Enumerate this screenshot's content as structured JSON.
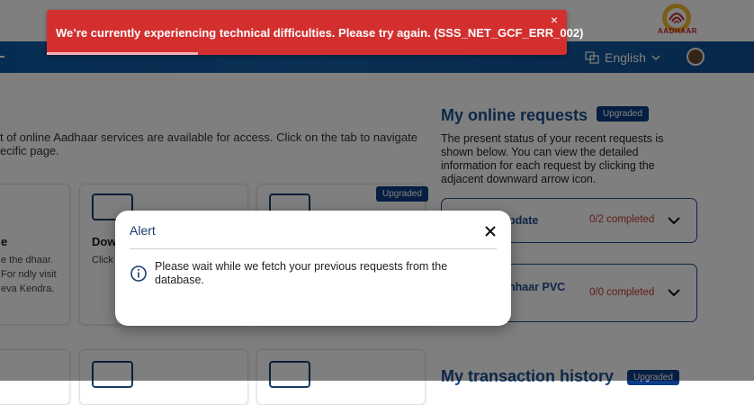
{
  "header": {
    "logo_text": "AADHAAR",
    "language": "English"
  },
  "intro": {
    "text": "t of online Aadhaar services are available for access. Click on the tab to navigate ecific page."
  },
  "cards": {
    "card1": {
      "title": "e",
      "desc": "e the dhaar. For ndly visit eva Kendra."
    },
    "card2": {
      "title": "Dow",
      "desc": "Click signe electr"
    },
    "card3": {
      "badge": "Upgraded"
    }
  },
  "requests": {
    "title": "My online requests",
    "badge": "Upgraded",
    "description": "The present status of your recent requests is shown below. You can view the detailed information for each request by clicking the adjacent downward arrow icon.",
    "items": [
      {
        "label": "pdate",
        "status": "0/2 completed"
      },
      {
        "label": "hhaar PVC",
        "status": "0/0 completed"
      }
    ]
  },
  "transactions": {
    "title": "My transaction history",
    "badge": "Upgraded"
  },
  "toast": {
    "message": "We’re currently experiencing technical difficulties. Please try again. (SSS_NET_GCF_ERR_002)",
    "close": "×",
    "progress_fraction": 0.29
  },
  "modal": {
    "title": "Alert",
    "message": "Please wait while we fetch your previous requests from the database."
  },
  "colors": {
    "toast_bg": "#d32f2f",
    "nav_bg": "#0b5aa3",
    "badge_bg": "#0c3c87",
    "accent": "#1a4f8c"
  }
}
